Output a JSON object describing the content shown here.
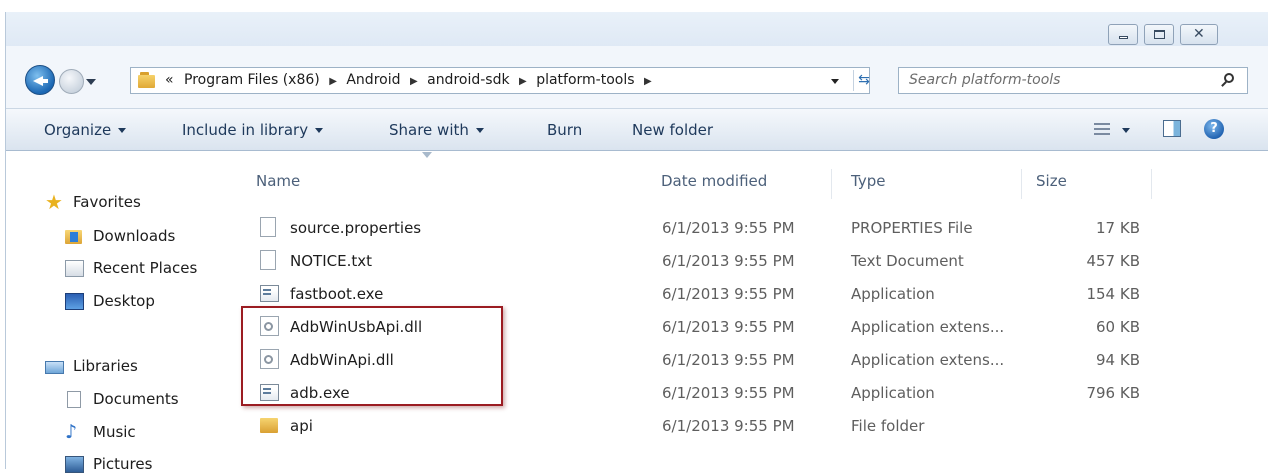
{
  "window": {
    "controls": [
      "minimize",
      "maximize",
      "close"
    ]
  },
  "address": {
    "overflow": "«",
    "crumbs": [
      "Program Files (x86)",
      "Android",
      "android-sdk",
      "platform-tools"
    ],
    "search_placeholder": "Search platform-tools"
  },
  "toolbar": {
    "organize": "Organize",
    "include": "Include in library",
    "share": "Share with",
    "burn": "Burn",
    "new_folder": "New folder"
  },
  "nav": {
    "favorites": "Favorites",
    "downloads": "Downloads",
    "recent": "Recent Places",
    "desktop": "Desktop",
    "libraries": "Libraries",
    "documents": "Documents",
    "music": "Music",
    "pictures": "Pictures"
  },
  "columns": {
    "name": "Name",
    "date": "Date modified",
    "type": "Type",
    "size": "Size"
  },
  "files": [
    {
      "name": "source.properties",
      "date": "6/1/2013 9:55 PM",
      "type": "PROPERTIES File",
      "size": "17 KB",
      "icon": "page"
    },
    {
      "name": "NOTICE.txt",
      "date": "6/1/2013 9:55 PM",
      "type": "Text Document",
      "size": "457 KB",
      "icon": "page"
    },
    {
      "name": "fastboot.exe",
      "date": "6/1/2013 9:55 PM",
      "type": "Application",
      "size": "154 KB",
      "icon": "exe"
    },
    {
      "name": "AdbWinUsbApi.dll",
      "date": "6/1/2013 9:55 PM",
      "type": "Application extens...",
      "size": "60 KB",
      "icon": "dll"
    },
    {
      "name": "AdbWinApi.dll",
      "date": "6/1/2013 9:55 PM",
      "type": "Application extens...",
      "size": "94 KB",
      "icon": "dll"
    },
    {
      "name": "adb.exe",
      "date": "6/1/2013 9:55 PM",
      "type": "Application",
      "size": "796 KB",
      "icon": "exe"
    },
    {
      "name": "api",
      "date": "6/1/2013 9:55 PM",
      "type": "File folder",
      "size": "",
      "icon": "folder"
    }
  ],
  "colors": {
    "highlight_border": "#9b1c22",
    "toolbar_text": "#1e395b"
  }
}
